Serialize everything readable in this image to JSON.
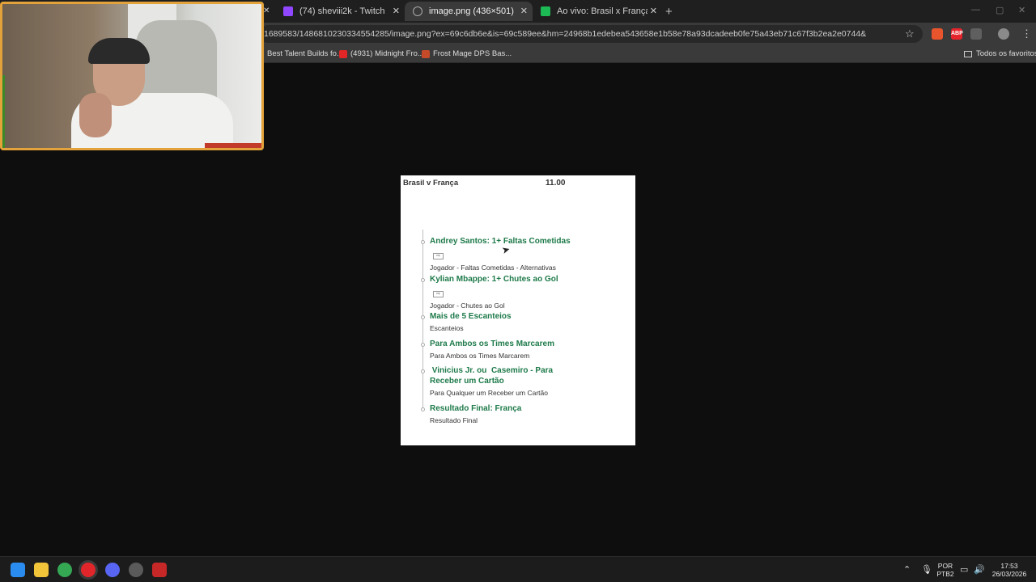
{
  "browser": {
    "tabs": [
      {
        "title": "(74) sheviii2k - Twitch",
        "favicon": "twitch-icon",
        "color": "#9146ff"
      },
      {
        "title": "image.png (436×501)",
        "favicon": "globe-icon",
        "color": "#777777"
      },
      {
        "title": "Ao vivo: Brasil x França | Amisto",
        "favicon": "betano-icon",
        "color": "#1db954"
      }
    ],
    "tab_close": "✕",
    "new_tab": "+",
    "url": "1689583/1486810230334554285/image.png?ex=69c6db6e&is=69c589ee&hm=24968b1edebea543658e1b58e78a93dcadeeb0fe75a43eb71c67f3b2ea2e0744&",
    "star": "☆",
    "extensions": [
      {
        "name": "fox-extension-icon",
        "label": "",
        "color": "#e8552c"
      },
      {
        "name": "abp-extension-icon",
        "label": "ABP",
        "color": "#e5252b"
      },
      {
        "name": "puzzle-extension-icon",
        "label": "",
        "color": "#5f5f5f"
      },
      {
        "name": "profile-icon",
        "label": "",
        "color": "#8a8a8a"
      }
    ],
    "menu": "⋮",
    "bookmarks": [
      {
        "label": "Best Talent Builds fo...",
        "color": "#333333"
      },
      {
        "label": "(4931) Midnight Fro...",
        "color": "#e02626"
      },
      {
        "label": "Frost Mage DPS Bas...",
        "color": "#c44a2a"
      }
    ],
    "all_bookmarks": "Todos os favoritos"
  },
  "slip": {
    "match": "Brasil v França",
    "odds": "11.00",
    "selections": [
      {
        "name": "Andrey Santos: 1+ Faltas Cometidas",
        "badge": true,
        "market": "Jogador - Faltas Cometidas - Alternativas"
      },
      {
        "name": "Kylian Mbappe: 1+ Chutes ao Gol",
        "badge": true,
        "market": "Jogador - Chutes ao Gol"
      },
      {
        "name": "Mais de 5 Escanteios",
        "badge": false,
        "market": "Escanteios"
      },
      {
        "name": "Para Ambos os Times Marcarem",
        "badge": false,
        "market": "Para Ambos os Times Marcarem"
      },
      {
        "name": " Vinicius Jr. ou  Casemiro - Para Receber um Cartão",
        "badge": false,
        "market": "Para Qualquer um Receber um Cartão"
      },
      {
        "name": "Resultado Final: França",
        "badge": false,
        "market": "Resultado Final"
      }
    ],
    "name_color": "#1e7a4a"
  },
  "taskbar": {
    "apps": [
      {
        "name": "windows-start-icon",
        "color": "#2b8cf0"
      },
      {
        "name": "file-explorer-icon",
        "color": "#f2c43a"
      },
      {
        "name": "chrome-icon",
        "color": "#34a853"
      },
      {
        "name": "opera-icon",
        "color": "#e0262b"
      },
      {
        "name": "discord-icon",
        "color": "#5865f2"
      },
      {
        "name": "steam-icon",
        "color": "#5a5a5a"
      },
      {
        "name": "app-icon",
        "color": "#c62828"
      }
    ],
    "lang": "POR",
    "layout": "PTB2",
    "time": "17:53",
    "date": "26/03/2026"
  }
}
